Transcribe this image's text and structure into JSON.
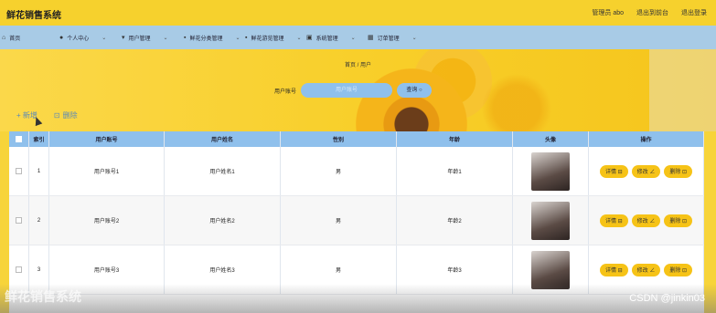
{
  "header": {
    "title": "鲜花销售系统",
    "admin": "管理员 abo",
    "links": [
      "退出到前台",
      "退出登录"
    ]
  },
  "nav": [
    {
      "label": "首页",
      "icon": "home-icon"
    },
    {
      "label": "个人中心",
      "icon": "user-icon"
    },
    {
      "label": "用户管理",
      "icon": "users-icon"
    },
    {
      "label": "鲜花分类管理",
      "icon": "category-icon"
    },
    {
      "label": "鲜花游览管理",
      "icon": "flower-icon"
    },
    {
      "label": "系统管理",
      "icon": "gear-icon"
    },
    {
      "label": "订单管理",
      "icon": "grid-icon"
    }
  ],
  "breadcrumb": "首页 / 用户",
  "search": {
    "label": "用户账号",
    "placeholder": "用户账号",
    "button": "查询 ○"
  },
  "actions": {
    "add": "+ 新增",
    "delete": "删除"
  },
  "table": {
    "columns": [
      "索引",
      "用户账号",
      "用户姓名",
      "性别",
      "年龄",
      "头像",
      "操作"
    ],
    "rows": [
      {
        "index": "1",
        "account": "用户账号1",
        "name": "用户姓名1",
        "gender": "男",
        "age": "年龄1"
      },
      {
        "index": "2",
        "account": "用户账号2",
        "name": "用户姓名2",
        "gender": "男",
        "age": "年龄2"
      },
      {
        "index": "3",
        "account": "用户账号3",
        "name": "用户姓名3",
        "gender": "男",
        "age": "年龄3"
      }
    ],
    "ops": [
      "详情 ⊟",
      "修改 ∠",
      "删除 ⊡"
    ]
  },
  "watermark": {
    "left": "鲜花销售系统",
    "right": "CSDN @jinkin03"
  }
}
